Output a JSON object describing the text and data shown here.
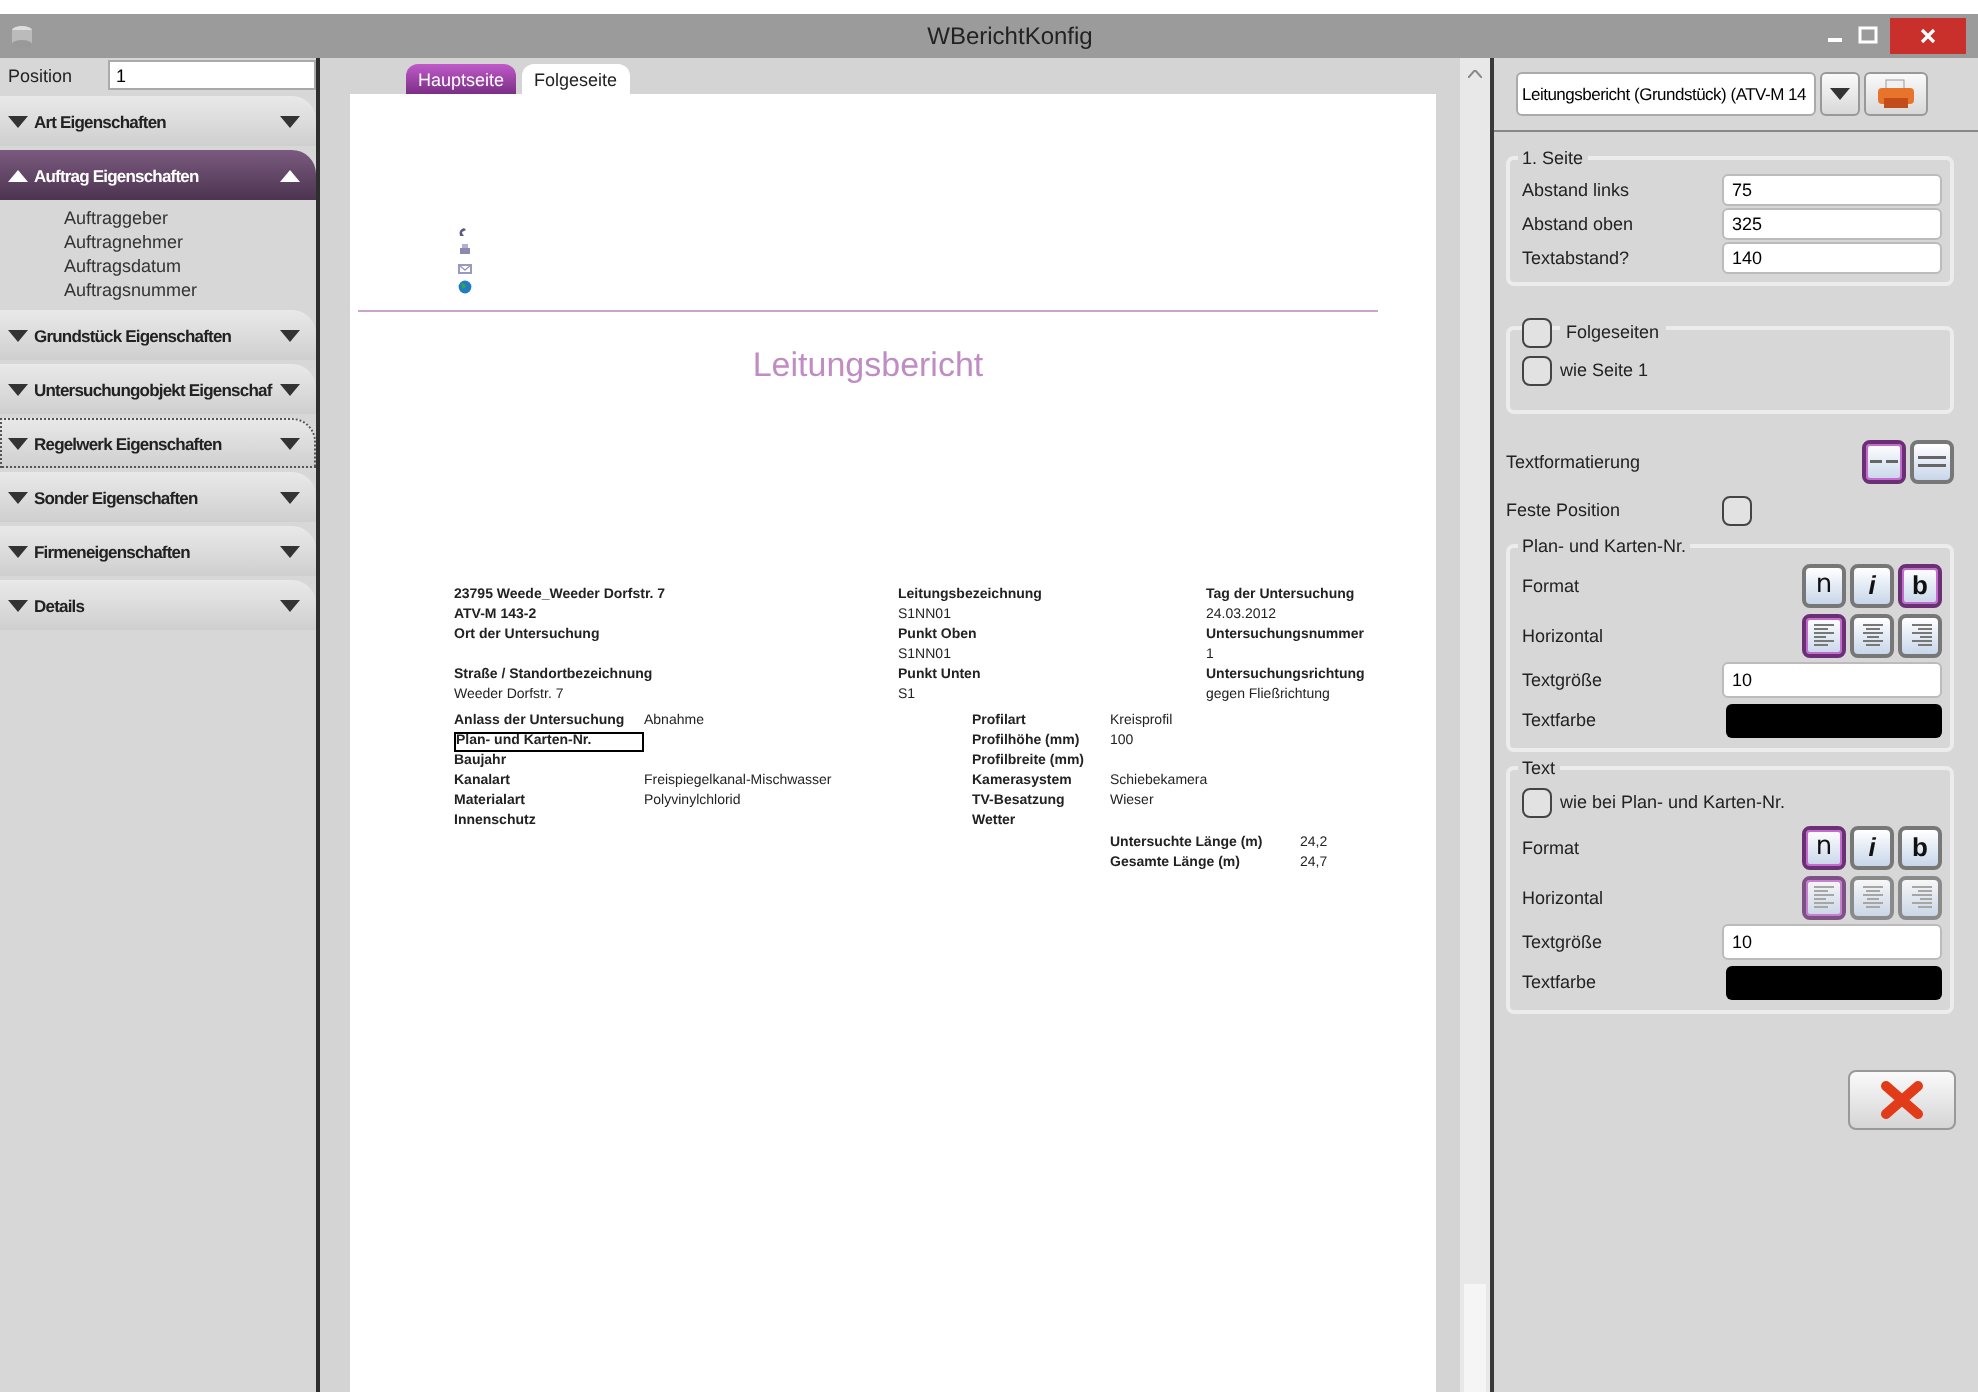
{
  "window": {
    "title": "WBerichtKonfig"
  },
  "sidebar": {
    "position": {
      "label": "Position",
      "value": "1"
    },
    "sections": [
      {
        "title": "Art Eigenschaften",
        "expanded": false,
        "focused": false
      },
      {
        "title": "Auftrag Eigenschaften",
        "expanded": true,
        "focused": false,
        "items": [
          "Auftraggeber",
          "Auftragnehmer",
          "Auftragsdatum",
          "Auftragsnummer"
        ]
      },
      {
        "title": "Grundstück Eigenschaften",
        "expanded": false,
        "focused": false
      },
      {
        "title": "Untersuchungobjekt Eigenschaf",
        "expanded": false,
        "focused": false
      },
      {
        "title": "Regelwerk Eigenschaften",
        "expanded": false,
        "focused": true
      },
      {
        "title": "Sonder Eigenschaften",
        "expanded": false,
        "focused": false
      },
      {
        "title": "Firmeneigenschaften",
        "expanded": false,
        "focused": false
      },
      {
        "title": "Details",
        "expanded": false,
        "focused": false
      }
    ]
  },
  "tabs": [
    {
      "label": "Hauptseite",
      "selected": true
    },
    {
      "label": "Folgeseite",
      "selected": false
    }
  ],
  "page": {
    "title": "Leitungsbericht",
    "header_rows": [
      [
        {
          "text": "23795 Weede_Weeder Dorfstr. 7",
          "bold": true
        },
        {
          "text": "Leitungsbezeichnung",
          "bold": true
        },
        {
          "text": "Tag der Untersuchung",
          "bold": true
        }
      ],
      [
        {
          "text": "ATV-M 143-2",
          "bold": true
        },
        {
          "text": "S1NN01",
          "bold": false
        },
        {
          "text": "24.03.2012",
          "bold": false
        }
      ],
      [
        {
          "text": "Ort der Untersuchung",
          "bold": true
        },
        {
          "text": "Punkt Oben",
          "bold": true
        },
        {
          "text": "Untersuchungsnummer",
          "bold": true
        }
      ],
      [
        null,
        {
          "text": "S1NN01",
          "bold": false
        },
        {
          "text": "1",
          "bold": false
        }
      ],
      [
        {
          "text": "Straße / Standortbezeichnung",
          "bold": true
        },
        {
          "text": "Punkt Unten",
          "bold": true
        },
        {
          "text": "Untersuchungsrichtung",
          "bold": true
        }
      ],
      [
        {
          "text": "Weeder Dorfstr. 7",
          "bold": false
        },
        {
          "text": "S1",
          "bold": false
        },
        {
          "text": "gegen Fließrichtung",
          "bold": false
        }
      ]
    ],
    "left_fields": [
      {
        "label": "Anlass der Untersuchung",
        "value": "Abnahme",
        "selected": false
      },
      {
        "label": "Plan- und Karten-Nr.",
        "selected": true
      },
      {
        "label": "Baujahr",
        "selected": false
      },
      {
        "label": "Kanalart",
        "value": "Freispiegelkanal-Mischwasser",
        "selected": false
      },
      {
        "label": "Materialart",
        "value": "Polyvinylchlorid",
        "selected": false
      },
      {
        "label": "Innenschutz",
        "selected": false
      }
    ],
    "right_fields": [
      {
        "label": "Profilart",
        "value": "Kreisprofil"
      },
      {
        "label": "Profilhöhe (mm)",
        "value": "100"
      },
      {
        "label": "Profilbreite (mm)"
      },
      {
        "label": "Kamerasystem",
        "value": "Schiebekamera"
      },
      {
        "label": "TV-Besatzung",
        "value": "Wieser"
      },
      {
        "label": "Wetter"
      }
    ],
    "lengths": [
      {
        "label": "Untersuchte Länge (m)",
        "value": "24,2"
      },
      {
        "label": "Gesamte Länge (m)",
        "value": "24,7"
      }
    ]
  },
  "settings": {
    "report_select": "Leitungsbericht (Grundstück) (ATV-M 14",
    "first_page": {
      "legend": "1. Seite",
      "fields": [
        {
          "label": "Abstand links",
          "value": "75"
        },
        {
          "label": "Abstand oben",
          "value": "325"
        },
        {
          "label": "Textabstand?",
          "value": "140"
        }
      ]
    },
    "following": {
      "legend": "Folgeseiten",
      "checked": false,
      "same_label": "wie Seite 1",
      "same_checked": false
    },
    "text_format": {
      "label": "Textformatierung",
      "options": [
        {
          "kind": "separated",
          "selected": true
        },
        {
          "kind": "lines",
          "selected": false
        }
      ]
    },
    "fixed_position": {
      "label": "Feste Position",
      "checked": false
    },
    "groups": [
      {
        "legend": "Plan- und Karten-Nr.",
        "disabled": false,
        "format_label": "Format",
        "formats": [
          {
            "label": "n",
            "kind": "normal",
            "selected": false
          },
          {
            "label": "i",
            "kind": "italic",
            "selected": false
          },
          {
            "label": "b",
            "kind": "bold",
            "selected": true
          }
        ],
        "align_label": "Horizontal",
        "aligns": [
          {
            "kind": "left",
            "selected": true
          },
          {
            "kind": "center",
            "selected": false
          },
          {
            "kind": "right",
            "selected": false
          }
        ],
        "size_label": "Textgröße",
        "size": "10",
        "color_label": "Textfarbe",
        "color": "#000000"
      },
      {
        "legend": "Text",
        "disabled": true,
        "same_label": "wie bei Plan- und Karten-Nr.",
        "same_checked": false,
        "format_label": "Format",
        "formats": [
          {
            "label": "n",
            "kind": "normal",
            "selected": true
          },
          {
            "label": "i",
            "kind": "italic",
            "selected": false
          },
          {
            "label": "b",
            "kind": "bold",
            "selected": false
          }
        ],
        "align_label": "Horizontal",
        "aligns": [
          {
            "kind": "left",
            "selected": true
          },
          {
            "kind": "center",
            "selected": false
          },
          {
            "kind": "right",
            "selected": false
          }
        ],
        "size_label": "Textgröße",
        "size": "10",
        "color_label": "Textfarbe",
        "color": "#000000"
      }
    ]
  }
}
